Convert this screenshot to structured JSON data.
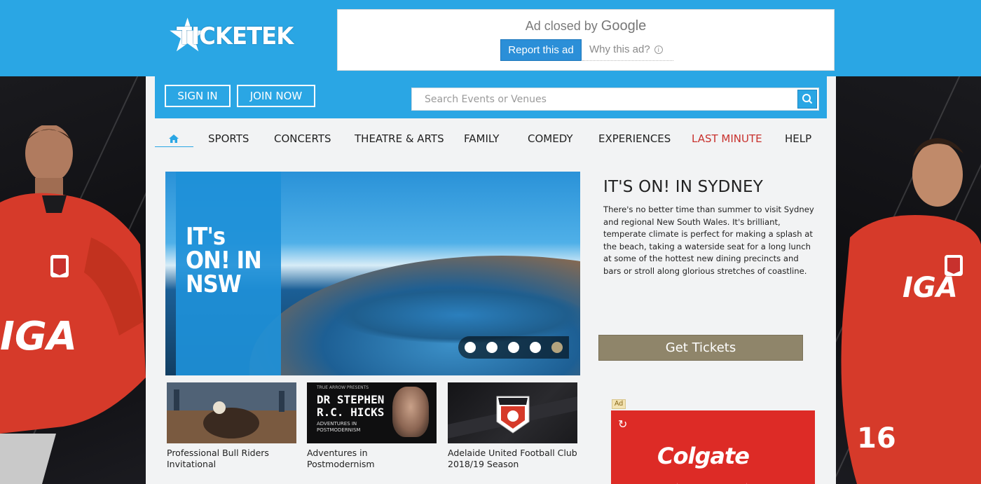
{
  "header": {
    "logo_text": "TICKETEK",
    "ad": {
      "closed_prefix": "Ad closed by",
      "closed_brand": "Google",
      "report_label": "Report this ad",
      "why_label": "Why this ad?"
    }
  },
  "userbar": {
    "sign_in": "SIGN IN",
    "join_now": "JOIN NOW",
    "search_placeholder": "Search Events or Venues"
  },
  "nav": {
    "items": [
      {
        "label": "SPORTS"
      },
      {
        "label": "CONCERTS"
      },
      {
        "label": "THEATRE & ARTS"
      },
      {
        "label": "FAMILY"
      },
      {
        "label": "COMEDY"
      },
      {
        "label": "EXPERIENCES"
      },
      {
        "label": "LAST MINUTE"
      },
      {
        "label": "HELP"
      }
    ]
  },
  "hero": {
    "overlay_text": "IT's ON! IN NSW",
    "slide_count": 5,
    "active_slide": 5
  },
  "promo": {
    "title": "IT'S ON! IN SYDNEY",
    "body": "There's no better time than summer to visit Sydney and regional New South Wales. It's brilliant, temperate climate is perfect for making a splash at the beach, taking a waterside seat for a long lunch at some of the hottest new dining precincts and bars or stroll along glorious stretches of coastline.",
    "cta": "Get Tickets"
  },
  "thumbs": [
    {
      "caption": "Professional Bull Riders Invitational"
    },
    {
      "caption": "Adventures in Postmodernism",
      "poster_small": "TRUE ARROW PRESENTS",
      "poster_title": "DR STEPHEN R.C. HICKS",
      "poster_sub": "ADVENTURES IN POSTMODERNISM"
    },
    {
      "caption": "Adelaide United Football Club 2018/19 Season"
    }
  ],
  "side_ad": {
    "label": "Ad",
    "brand": "Colgate"
  },
  "side_banner": {
    "sponsor": "IGA",
    "jersey_number": "16"
  },
  "colors": {
    "brand_blue": "#2aa6e4",
    "last_minute_red": "#c8312d",
    "cta_gold": "#8f856a",
    "colgate_red": "#dd2b26"
  }
}
